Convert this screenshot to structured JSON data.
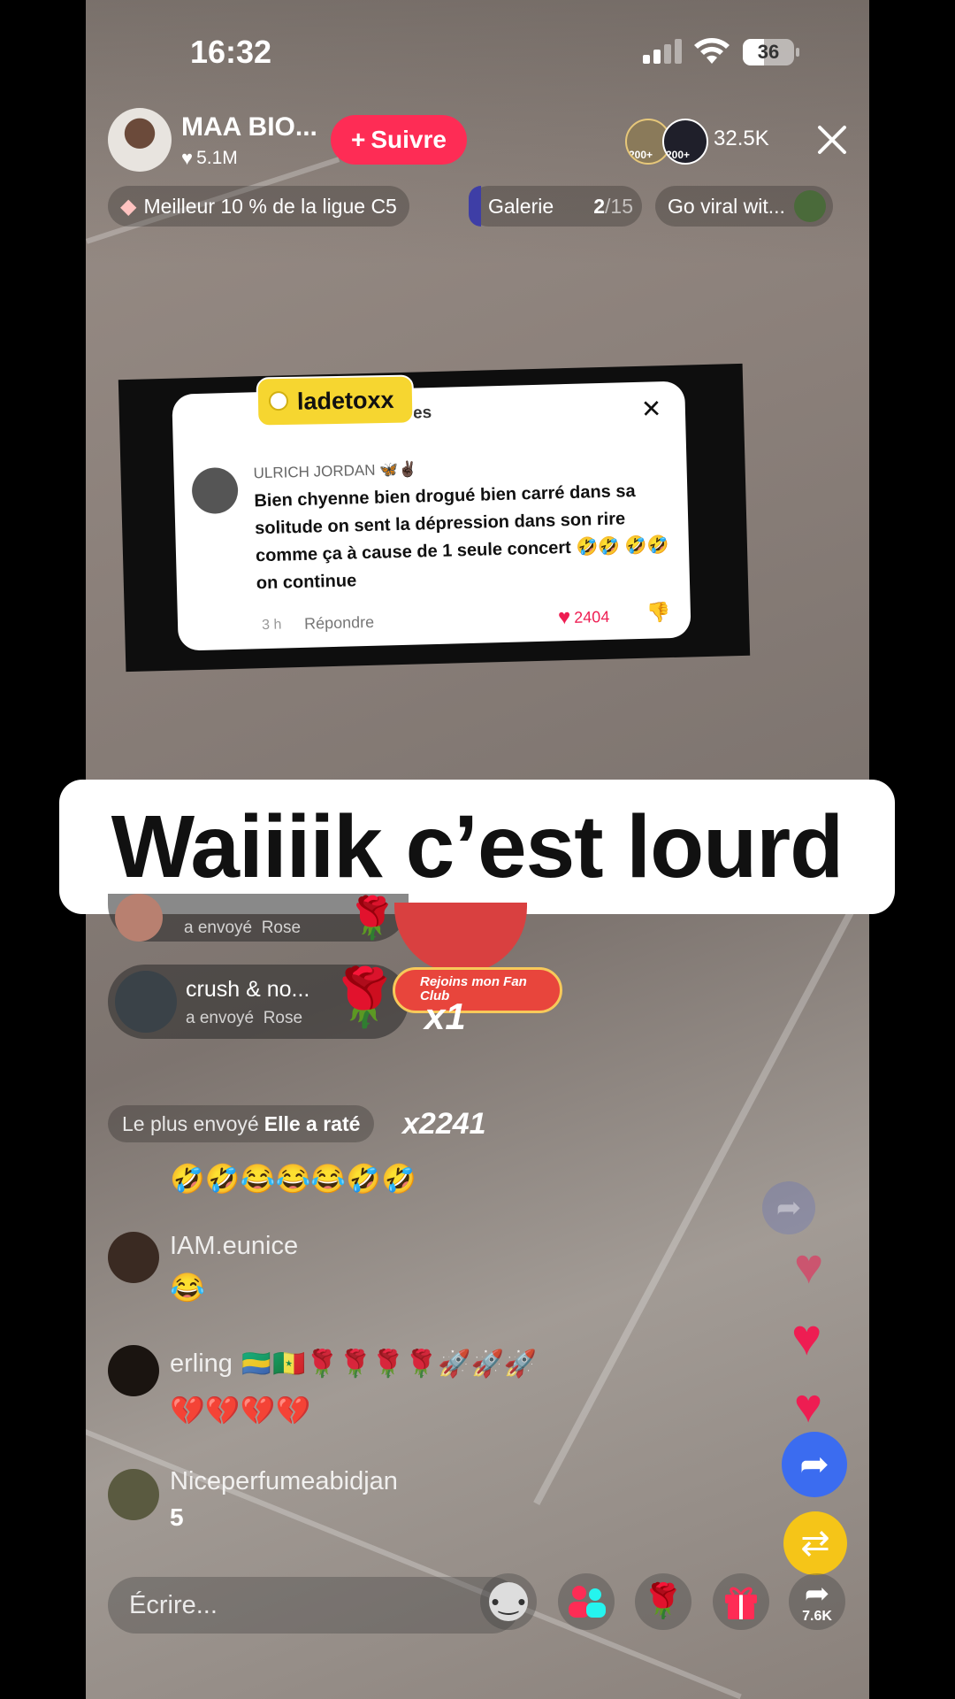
{
  "status": {
    "time": "16:32",
    "battery": "36"
  },
  "host": {
    "name": "MAA BIO...",
    "likes": "5.1M",
    "follow_label": "Suivre",
    "viewers": "32.5K",
    "badge1": "200+",
    "badge2": "200+"
  },
  "chips": {
    "league": "Meilleur 10 % de la ligue C5",
    "gallery": "Galerie",
    "gallery_current": "2",
    "gallery_total": "/15",
    "promo": "Go viral wit..."
  },
  "comment_card": {
    "tag": "ladetoxx",
    "header": "ommentaires",
    "user": "ULRICH JORDAN",
    "user_emojis": "🦋✌🏿",
    "text": "Bien chyenne bien drogué bien carré dans sa solitude on sent la dépression dans son rire comme ça à cause de 1 seule concert 🤣🤣 🤣🤣 on continue",
    "time": "3 h",
    "reply": "Répondre",
    "likes": "2404"
  },
  "caption": "Waiiiik c’est lourd",
  "gifts": [
    {
      "action": "a envoyé",
      "gift": "Rose"
    },
    {
      "user": "crush & no...",
      "action": "a envoyé",
      "gift": "Rose"
    }
  ],
  "fan_club": {
    "label": "Rejoins mon Fan Club",
    "multiplier": "x1"
  },
  "most_sent": {
    "label": "Le plus envoyé",
    "value": "Elle a raté",
    "count": "x2241"
  },
  "chat": [
    {
      "user": "",
      "message": "🤣🤣😂😂😂🤣🤣"
    },
    {
      "user": "IAM.eunice",
      "message": "😂"
    },
    {
      "user": "erling",
      "user_emojis": "🇬🇦🇸🇳🌹🌹🌹🌹🚀🚀🚀",
      "message": "💔💔💔💔"
    },
    {
      "user": "Niceperfumeabidjan",
      "message": "5"
    }
  ],
  "input": {
    "placeholder": "Écrire..."
  },
  "share": {
    "count": "7.6K"
  },
  "colors": {
    "follow": "#fe2c55",
    "tag": "#f6d630",
    "heart": "#ee1d52",
    "share_blue": "#3b6cf0",
    "repost": "#f5c518"
  }
}
